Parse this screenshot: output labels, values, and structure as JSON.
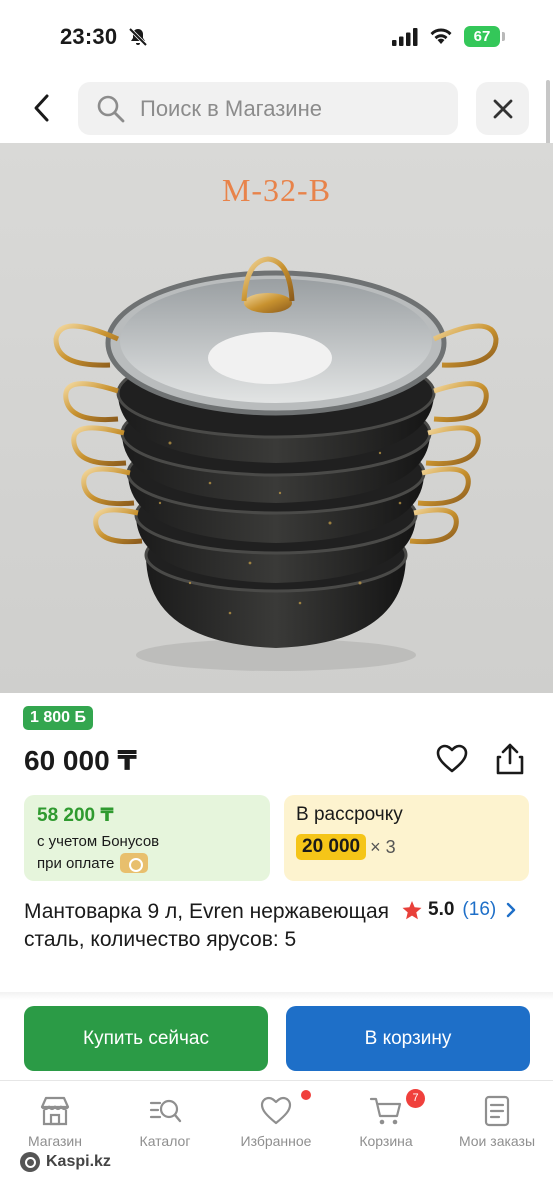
{
  "status_bar": {
    "time": "23:30",
    "battery": "67"
  },
  "header": {
    "search_placeholder": "Поиск в Магазине"
  },
  "product_image": {
    "caption": "M-32-B"
  },
  "product": {
    "bonus_badge": "1 800 Б",
    "price": "60 000 ₸",
    "bonus_card": {
      "price": "58 200 ₸",
      "line1": "с учетом Бонусов",
      "line2": "при оплате"
    },
    "installment_card": {
      "label": "В рассрочку",
      "amount": "20 000",
      "multiplier": "× 3"
    },
    "title": "Мантоварка 9 л, Evren нержавеющая сталь, количество ярусов: 5",
    "rating": {
      "score": "5.0",
      "count": "(16)"
    }
  },
  "actions": {
    "buy_now": "Купить сейчас",
    "add_to_cart": "В корзину"
  },
  "tab_bar": {
    "items": [
      {
        "label": "Магазин",
        "icon": "store-icon"
      },
      {
        "label": "Каталог",
        "icon": "catalog-search-icon"
      },
      {
        "label": "Избранное",
        "icon": "heart-icon"
      },
      {
        "label": "Корзина",
        "icon": "cart-icon"
      },
      {
        "label": "Мои заказы",
        "icon": "orders-icon"
      }
    ],
    "cart_count": "7"
  },
  "footer": {
    "brand": "Kaspi.kz"
  },
  "colors": {
    "green": "#2b9b46",
    "blue": "#1e6fc8",
    "red": "#f0403c",
    "yellow": "#f5c518"
  }
}
